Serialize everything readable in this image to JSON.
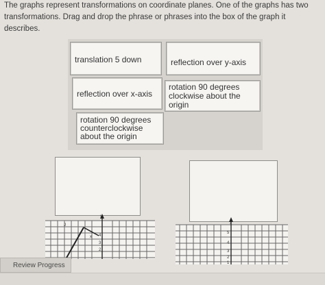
{
  "instructions": "The graphs represent transformations on coordinate planes. One of the graphs has two transformations. Drag and drop the phrase or phrases into the box of the graph it describes.",
  "tiles": [
    "translation 5 down",
    "reflection over y-axis",
    "reflection over x-axis",
    "rotation 90 degrees clockwise about the origin",
    "rotation 90 degrees counterclockwise about the origin"
  ],
  "graph_left": {
    "axis_label_y": "y",
    "axis_label_x": "x",
    "tick_labels": [
      "4",
      "3",
      "2"
    ],
    "point_label": "J"
  },
  "graph_right": {
    "axis_label_y": "y",
    "tick_labels": [
      "5",
      "4",
      "3",
      "2",
      "1"
    ]
  },
  "review_progress": "Review Progress",
  "colors": {
    "background": "#e4e1dc",
    "tile_bg": "#f6f5f2",
    "grid": "#555555"
  }
}
